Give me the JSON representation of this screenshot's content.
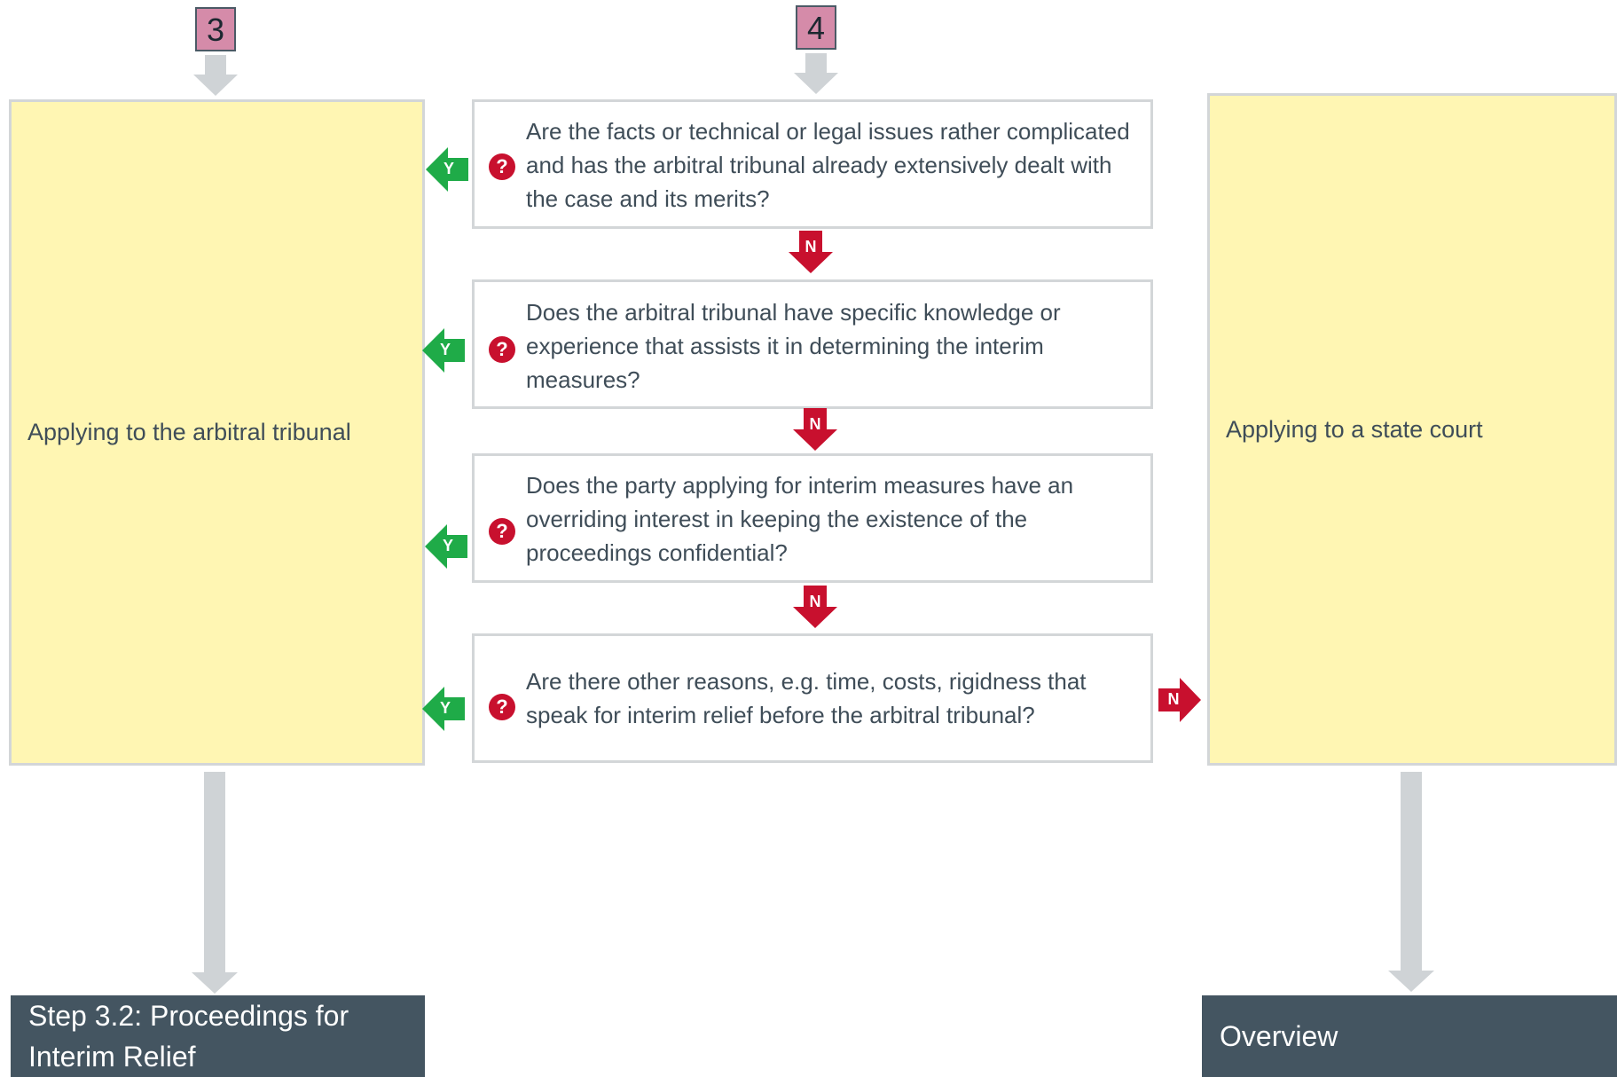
{
  "badges": {
    "left": "3",
    "center": "4"
  },
  "left_box": {
    "label": "Applying to the arbitral tribunal"
  },
  "right_box": {
    "label": "Applying to a state court"
  },
  "questions": [
    {
      "text": "Are the facts or technical or legal issues rather complicated and has the arbitral tribunal already extensively dealt with the case and its merits?"
    },
    {
      "text": "Does the arbitral tribunal have specific knowledge or experience that assists it in determining the interim measures?"
    },
    {
      "text": "Does the party applying for interim measures have an overriding interest in keeping the existence of the proceedings confidential?"
    },
    {
      "text": "Are there other reasons, e.g. time, costs, rigidness that speak for interim relief before the arbitral tribunal?"
    }
  ],
  "question_icon": "question-mark-icon",
  "yes_label": "Y",
  "no_label": "N",
  "nav": {
    "left": "Step 3.2: Proceedings for Interim Relief",
    "right": "Overview"
  },
  "colors": {
    "yes": "#1fab48",
    "no": "#c8102e",
    "box_fill": "#fff6b3",
    "nav_fill": "#445561",
    "badge_fill": "#d58ba9",
    "connector": "#cfd3d6"
  }
}
